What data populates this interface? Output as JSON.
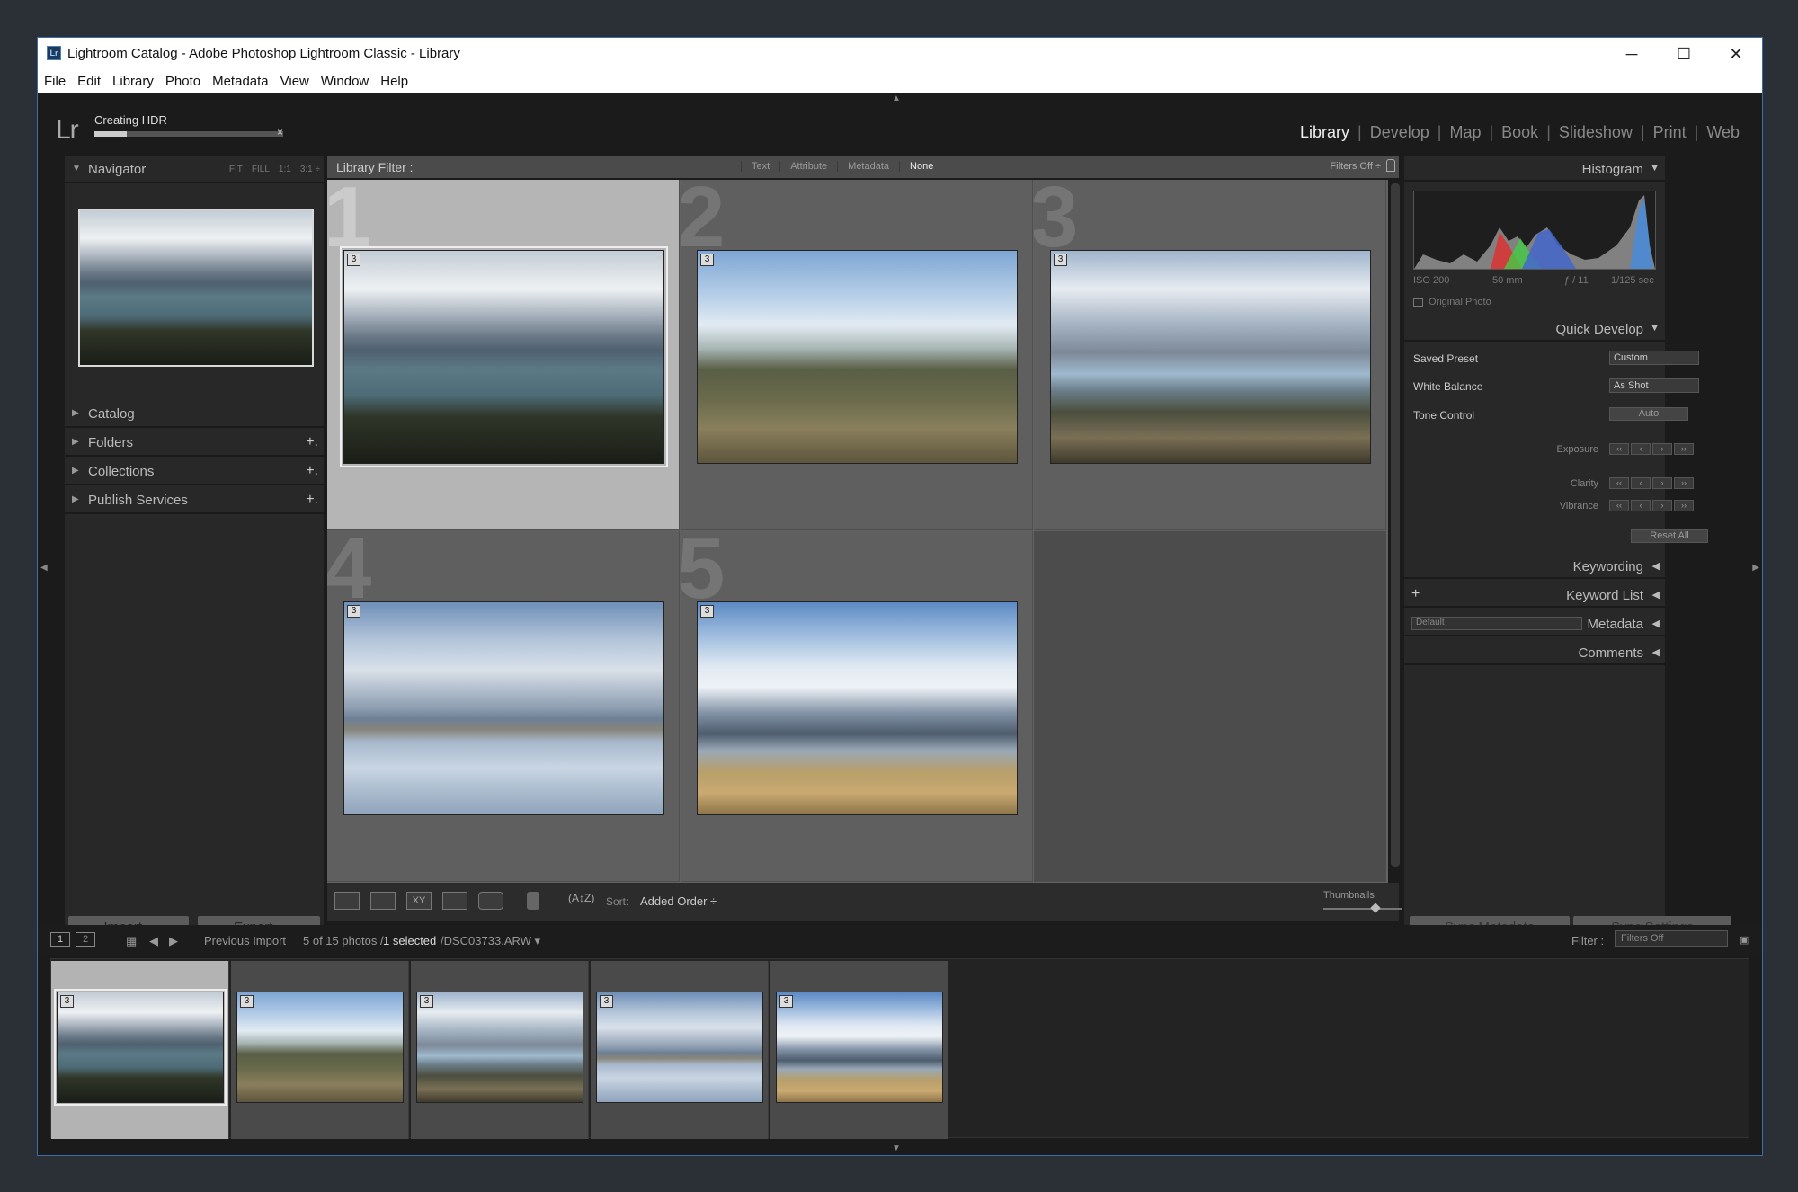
{
  "window": {
    "title": "Lightroom Catalog - Adobe Photoshop Lightroom Classic - Library",
    "app_icon": "Lr"
  },
  "menu": [
    "File",
    "Edit",
    "Library",
    "Photo",
    "Metadata",
    "View",
    "Window",
    "Help"
  ],
  "identity": {
    "logo": "Lr",
    "status": "Creating HDR",
    "progress": 0.17,
    "cancel": "×"
  },
  "modules": [
    "Library",
    "Develop",
    "Map",
    "Book",
    "Slideshow",
    "Print",
    "Web"
  ],
  "active_module": "Library",
  "left_panel": {
    "navigator": {
      "label": "Navigator",
      "zoom": [
        "FIT",
        "FILL",
        "1:1",
        "3:1"
      ]
    },
    "sections": [
      {
        "label": "Catalog",
        "plus": ""
      },
      {
        "label": "Folders",
        "plus": "+."
      },
      {
        "label": "Collections",
        "plus": "+."
      },
      {
        "label": "Publish Services",
        "plus": "+."
      }
    ],
    "import_label": "Import...",
    "export_label": "Export..."
  },
  "filter_bar": {
    "title": "Library Filter :",
    "options": [
      "Text",
      "Attribute",
      "Metadata",
      "None"
    ],
    "active": "None",
    "filters_off": "Filters Off ÷"
  },
  "grid": [
    {
      "index": "1",
      "badge": "3",
      "selected": true
    },
    {
      "index": "2",
      "badge": "3",
      "selected": false
    },
    {
      "index": "3",
      "badge": "3",
      "selected": false
    },
    {
      "index": "4",
      "badge": "3",
      "selected": false
    },
    {
      "index": "5",
      "badge": "3",
      "selected": false
    }
  ],
  "toolbar": {
    "sort_label": "Sort:",
    "sort_value": "Added Order ÷",
    "thumbnails_label": "Thumbnails"
  },
  "right_panel": {
    "histogram": {
      "label": "Histogram",
      "iso": "ISO 200",
      "focal": "50 mm",
      "aperture": "ƒ / 11",
      "shutter": "1/125 sec",
      "original_photo": "Original Photo"
    },
    "quick_develop": {
      "label": "Quick Develop",
      "saved_preset_label": "Saved Preset",
      "saved_preset_value": "Custom",
      "white_balance_label": "White Balance",
      "white_balance_value": "As Shot",
      "tone_control_label": "Tone Control",
      "auto_label": "Auto",
      "exposure_label": "Exposure",
      "clarity_label": "Clarity",
      "vibrance_label": "Vibrance",
      "reset_label": "Reset All"
    },
    "keywording": "Keywording",
    "keyword_list": "Keyword List",
    "metadata": "Metadata",
    "metadata_preset": "Default",
    "comments": "Comments",
    "sync_metadata": "Sync Metadata",
    "sync_settings": "Sync Settings"
  },
  "filmstrip_bar": {
    "page1": "1",
    "page2": "2",
    "source": "Previous Import",
    "count_prefix": "5 of 15 photos /",
    "selected_text": "1 selected",
    "file": "/DSC03733.ARW ▾",
    "filter_label": "Filter :",
    "filter_value": "Filters Off"
  },
  "filmstrip": [
    {
      "badge": "3",
      "selected": true
    },
    {
      "badge": "3",
      "selected": false
    },
    {
      "badge": "3",
      "selected": false
    },
    {
      "badge": "3",
      "selected": false
    },
    {
      "badge": "3",
      "selected": false
    }
  ]
}
